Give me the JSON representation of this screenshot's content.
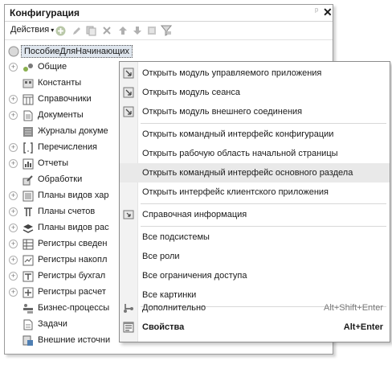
{
  "panel": {
    "title": "Конфигурация",
    "pin_glyph": "ᵖ",
    "close_glyph": "✕",
    "toolbar": {
      "actions_label": "Действия",
      "actions_arrow": "▾",
      "icons": [
        "add-icon",
        "edit-icon",
        "copy-icon",
        "delete-icon",
        "move-up-icon",
        "move-down-icon",
        "list-icon",
        "filter-icon"
      ]
    }
  },
  "tree": {
    "root": "ПособиеДляНачинающих",
    "items": [
      {
        "label": "Общие",
        "icon": "common-icon",
        "expandable": true
      },
      {
        "label": "Константы",
        "icon": "constants-icon",
        "expandable": false
      },
      {
        "label": "Справочники",
        "icon": "catalogs-icon",
        "expandable": true
      },
      {
        "label": "Документы",
        "icon": "documents-icon",
        "expandable": true
      },
      {
        "label": "Журналы докуме",
        "icon": "journals-icon",
        "expandable": false
      },
      {
        "label": "Перечисления",
        "icon": "enums-icon",
        "expandable": true
      },
      {
        "label": "Отчеты",
        "icon": "reports-icon",
        "expandable": true
      },
      {
        "label": "Обработки",
        "icon": "processing-icon",
        "expandable": false
      },
      {
        "label": "Планы видов хар",
        "icon": "chart-types-icon",
        "expandable": true
      },
      {
        "label": "Планы счетов",
        "icon": "accounts-icon",
        "expandable": true
      },
      {
        "label": "Планы видов рас",
        "icon": "calc-types-icon",
        "expandable": true
      },
      {
        "label": "Регистры сведен",
        "icon": "info-register-icon",
        "expandable": true
      },
      {
        "label": "Регистры накопл",
        "icon": "accum-register-icon",
        "expandable": true
      },
      {
        "label": "Регистры бухгал",
        "icon": "acct-register-icon",
        "expandable": true
      },
      {
        "label": "Регистры расчет",
        "icon": "calc-register-icon",
        "expandable": true
      },
      {
        "label": "Бизнес-процессы",
        "icon": "business-process-icon",
        "expandable": false
      },
      {
        "label": "Задачи",
        "icon": "tasks-icon",
        "expandable": false
      },
      {
        "label": "Внешние источни",
        "icon": "external-sources-icon",
        "expandable": false
      }
    ]
  },
  "context_menu": {
    "items": [
      {
        "label": "Открыть модуль управляемого приложения",
        "icon": "module-icon"
      },
      {
        "label": "Открыть модуль сеанса",
        "icon": "module-icon"
      },
      {
        "label": "Открыть модуль внешнего соединения",
        "icon": "module-icon"
      },
      {
        "label": "Открыть командный интерфейс конфигурации"
      },
      {
        "label": "Открыть рабочую область начальной страницы"
      },
      {
        "label": "Открыть командный интерфейс основного раздела",
        "highlighted": true
      },
      {
        "label": "Открыть интерфейс клиентского приложения"
      },
      {
        "label": "Справочная информация",
        "icon": "help-icon"
      },
      {
        "label": "Все подсистемы"
      },
      {
        "label": "Все роли"
      },
      {
        "label": "Все ограничения доступа"
      },
      {
        "label": "Все картинки"
      },
      {
        "label": "Дополнительно",
        "shortcut": "Alt+Shift+Enter",
        "icon": "additional-icon"
      },
      {
        "label": "Свойства",
        "shortcut": "Alt+Enter",
        "icon": "properties-icon",
        "bold": true
      }
    ]
  },
  "colors": {
    "highlight": "#e9e9e9",
    "root_selection": "#dfe6ee",
    "gutter": "#f2f2f2"
  }
}
